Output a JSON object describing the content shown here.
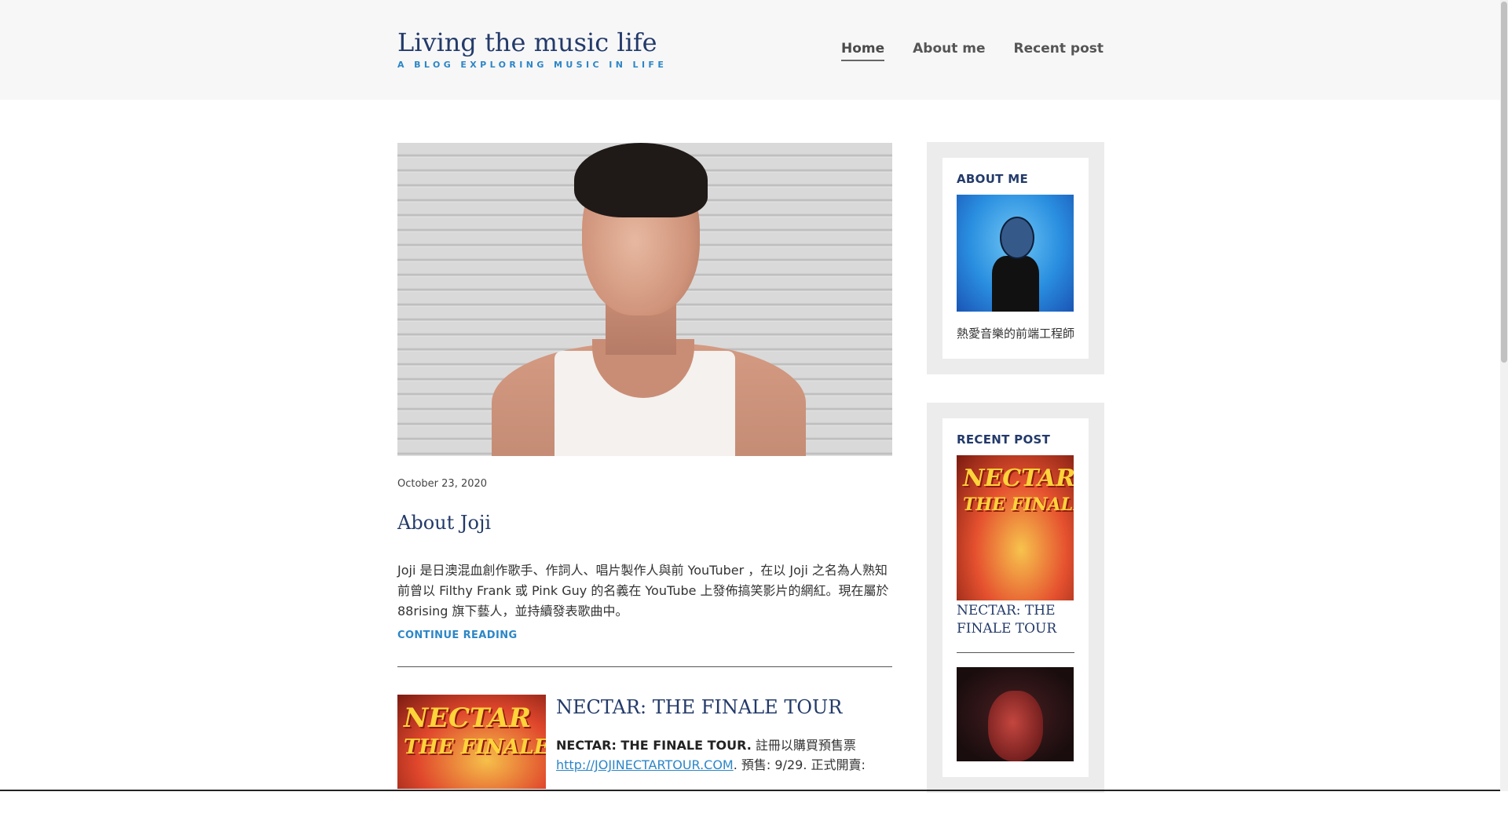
{
  "site": {
    "title": "Living the music life",
    "tagline": "A BLOG EXPLORING MUSIC IN LIFE"
  },
  "nav": {
    "items": [
      {
        "label": "Home",
        "active": true
      },
      {
        "label": "About me",
        "active": false
      },
      {
        "label": "Recent post",
        "active": false
      }
    ]
  },
  "main": {
    "featured": {
      "date": "October 23, 2020",
      "title": "About Joji",
      "excerpt": "Joji 是日澳混血創作歌手、作詞人、唱片製作人與前 YouTuber ，在以 Joji 之名為人熟知前曾以 Filthy Frank 或 Pink Guy 的名義在 YouTube 上發佈搞笑影片的網紅。現在屬於 88rising 旗下藝人，並持續發表歌曲中。",
      "continue_label": "CONTINUE READING"
    },
    "second": {
      "title": "NECTAR: THE FINALE TOUR",
      "lead_bold": "NECTAR: THE FINALE TOUR.",
      "lead_text": " 註冊以購買預售票",
      "link_text": "http://JOJINECTARTOUR.COM",
      "trail_text": ". 預售: 9/29. 正式開賣:",
      "thumb_text_1": "NECTAR",
      "thumb_text_2": "THE FINALE"
    }
  },
  "sidebar": {
    "about": {
      "heading": "ABOUT ME",
      "text": "熱愛音樂的前端工程師"
    },
    "recent": {
      "heading": "RECENT POST",
      "post_title": "NECTAR: THE FINALE TOUR",
      "thumb_text_1": "NECTAR",
      "thumb_text_2": "THE FINALE"
    }
  },
  "colors": {
    "brand": "#233a6a",
    "accent": "#2c86c7",
    "header_bg": "#f7f7f7"
  }
}
